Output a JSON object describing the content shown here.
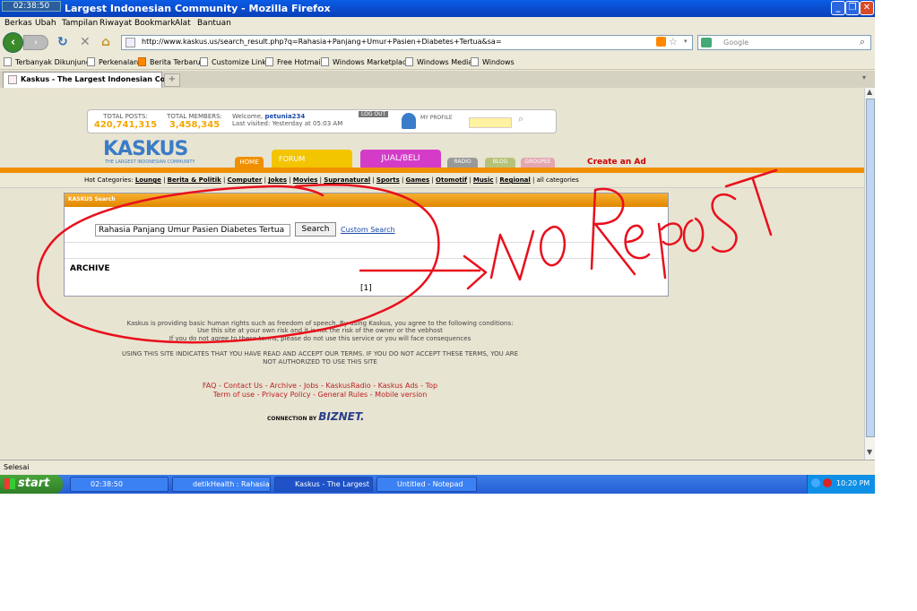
{
  "window": {
    "title": "Largest Indonesian Community - Mozilla Firefox",
    "clock_overlay": "02:38:50"
  },
  "menu": [
    "Berkas",
    "Ubah",
    "Tampilan",
    "Riwayat",
    "Bookmark",
    "Alat",
    "Bantuan"
  ],
  "nav": {
    "url": "http://www.kaskus.us/search_result.php?q=Rahasia+Panjang+Umur+Pasien+Diabetes+Tertua&sa=",
    "search_placeholder": "Google"
  },
  "bookmarks": [
    "Terbanyak Dikunjungi",
    "Perkenalan",
    "Berita Terbaru",
    "Customize Links",
    "Free Hotmail",
    "Windows Marketplace",
    "Windows Media",
    "Windows"
  ],
  "tabs": [
    {
      "label": "Kaskus - The Largest Indonesian Co..."
    }
  ],
  "page": {
    "total_posts_label": "TOTAL POSTS:",
    "total_posts": "420,741,315",
    "total_members_label": "TOTAL MEMBERS:",
    "total_members": "3,458,345",
    "welcome": "Welcome,",
    "username": "petunia234",
    "last_visited": "Last visited: Yesterday at 05:03 AM",
    "logout": "LOG OUT",
    "my_profile": "MY PROFILE",
    "logo": "KASKUS",
    "logo_sub": "THE LARGEST INDONESIAN COMMUNITY",
    "nav_tabs": [
      "HOME",
      "FORUM",
      "JUAL/BELI",
      "RADIO",
      "BLOG",
      "GROUPEE"
    ],
    "create_ad": "Create an Ad",
    "hot_label": "Hot Categories:",
    "hot_categories": [
      "Lounge",
      "Berita & Politik",
      "Computer",
      "Jokes",
      "Movies",
      "Supranatural",
      "Sports",
      "Games",
      "Otomotif",
      "Music",
      "Regional"
    ],
    "all_categories": "all categories",
    "search_header": "KASKUS Search",
    "search_value": "Rahasia Panjang Umur Pasien Diabetes Tertua",
    "search_button": "Search",
    "custom_search": "Custom Search",
    "archive": "ARCHIVE",
    "page_link": "[1]",
    "footer1": "Kaskus is providing basic human rights such as freedom of speech. By using Kaskus, you agree to the following conditions:",
    "footer2": "Use this site at your own risk and it is not the risk of the owner or the vebhost",
    "footer3": "If you do not agree to these terms, please do not use this service or you will face consequences",
    "footer4": "USING THIS SITE INDICATES THAT YOU HAVE READ AND ACCEPT OUR TERMS. IF YOU DO NOT ACCEPT THESE TERMS, YOU ARE",
    "footer5": "NOT AUTHORIZED TO USE THIS SITE",
    "links1": "FAQ - Contact Us - Archive - Jobs - KaskusRadio - Kaskus Ads - Top",
    "links2": "Term of use - Privacy Policy - General Rules - Mobile version",
    "connection_by": "CONNECTION BY",
    "biznet": "BIZNET."
  },
  "annotation": "NO Repost",
  "status": "Selesai",
  "taskbar": {
    "start": "start",
    "tasks": [
      "02:38:50",
      "detikHealth : Rahasia...",
      "Kaskus - The Largest ...",
      "Untitled - Notepad"
    ],
    "time": "10:20 PM"
  },
  "colors": {
    "scribble": "#e8101c",
    "accent": "#f09000"
  }
}
